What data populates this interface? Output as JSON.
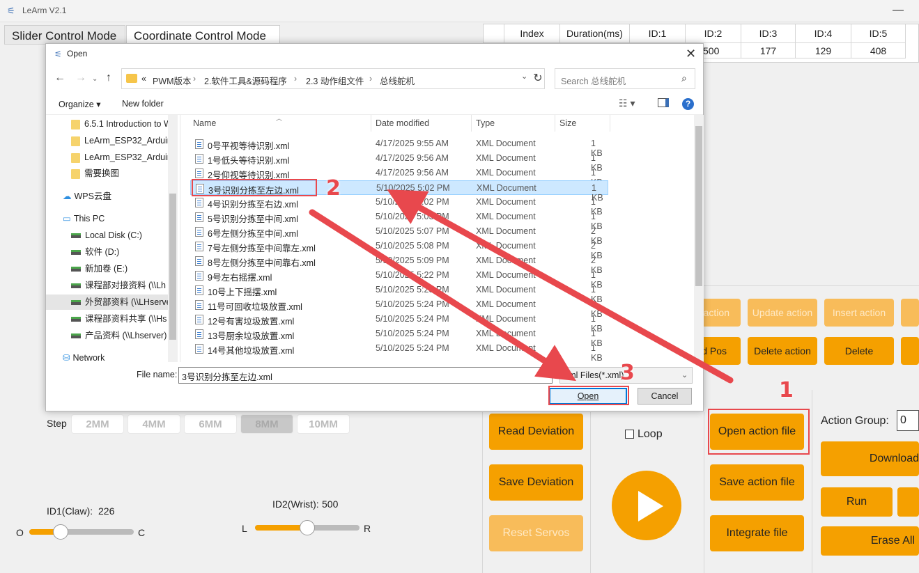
{
  "app": {
    "title": "LeArm V2.1",
    "minimize": "—"
  },
  "tabs": {
    "slider": "Slider Control Mode",
    "coordinate": "Coordinate Control Mode"
  },
  "grid": {
    "headers": [
      "Index",
      "Duration(ms)",
      "ID:1",
      "ID:2",
      "ID:3",
      "ID:4",
      "ID:5"
    ],
    "row": [
      "500",
      "177",
      "129",
      "408"
    ]
  },
  "step": {
    "label": "Step",
    "options": [
      "2MM",
      "4MM",
      "6MM",
      "8MM",
      "10MM"
    ],
    "selected": "8MM"
  },
  "sliders": {
    "id1": {
      "label": "ID1(Claw):",
      "value": "226",
      "left": "O",
      "right": "C",
      "level": 0.2
    },
    "id2": {
      "label": "ID2(Wrist):",
      "value": "500",
      "left": "L",
      "right": "R",
      "level": 0.5
    }
  },
  "buttons": {
    "action": "action",
    "update_action": "Update action",
    "insert_action": "Insert action",
    "d_pos": "d Pos",
    "delete_action": "Delete action",
    "delete": "Delete",
    "read_deviation": "Read Deviation",
    "save_deviation": "Save Deviation",
    "reset_servos": "Reset Servos",
    "loop": "Loop",
    "open_action_file": "Open action file",
    "save_action_file": "Save action file",
    "integrate_file": "Integrate file",
    "action_group_label": "Action Group:",
    "action_group_value": "0",
    "download": "Download",
    "run": "Run",
    "erase_all": "Erase All"
  },
  "dialog": {
    "title": "Open",
    "close": "✕",
    "breadcrumb": [
      "«",
      "PWM版本",
      "›",
      "2.软件工具&源码程序",
      "›",
      "2.3 动作组文件",
      "›",
      "总线舵机"
    ],
    "search_placeholder": "Search 总线舵机",
    "organize": "Organize ▾",
    "new_folder": "New folder",
    "nav": [
      {
        "label": "6.5.1 Introduction to W",
        "kind": "folder"
      },
      {
        "label": "LeArm_ESP32_Arduino",
        "kind": "folder"
      },
      {
        "label": "LeArm_ESP32_Arduino",
        "kind": "folder"
      },
      {
        "label": "需要换图",
        "kind": "folder"
      },
      {
        "label": "WPS云盘",
        "kind": "cloud"
      },
      {
        "label": "This PC",
        "kind": "pc"
      },
      {
        "label": "Local Disk (C:)",
        "kind": "drive"
      },
      {
        "label": "软件 (D:)",
        "kind": "drive"
      },
      {
        "label": "新加卷 (E:)",
        "kind": "drive"
      },
      {
        "label": "课程部对接资料 (\\\\Lh",
        "kind": "net"
      },
      {
        "label": "外贸部资料 (\\\\LHserve",
        "kind": "net"
      },
      {
        "label": "课程部资料共享 (\\\\Hs",
        "kind": "net"
      },
      {
        "label": "产品资料 (\\\\Lhserver)",
        "kind": "net"
      },
      {
        "label": "Network",
        "kind": "network"
      }
    ],
    "columns": {
      "name": "Name",
      "date": "Date modified",
      "type": "Type",
      "size": "Size"
    },
    "files": [
      {
        "name": "0号平视等待识别.xml",
        "date": "4/17/2025 9:55 AM",
        "type": "XML Document",
        "size": "1 KB"
      },
      {
        "name": "1号低头等待识别.xml",
        "date": "4/17/2025 9:56 AM",
        "type": "XML Document",
        "size": "1 KB"
      },
      {
        "name": "2号仰视等待识别.xml",
        "date": "4/17/2025 9:56 AM",
        "type": "XML Document",
        "size": "1 KB"
      },
      {
        "name": "3号识别分拣至左边.xml",
        "date": "5/10/2025 5:02 PM",
        "type": "XML Document",
        "size": "1 KB"
      },
      {
        "name": "4号识别分拣至右边.xml",
        "date": "5/10/2025 5:02 PM",
        "type": "XML Document",
        "size": "1 KB"
      },
      {
        "name": "5号识别分拣至中间.xml",
        "date": "5/10/2025 5:03 PM",
        "type": "XML Document",
        "size": "1 KB"
      },
      {
        "name": "6号左侧分拣至中间.xml",
        "date": "5/10/2025 5:07 PM",
        "type": "XML Document",
        "size": "2 KB"
      },
      {
        "name": "7号左侧分拣至中间靠左.xml",
        "date": "5/10/2025 5:08 PM",
        "type": "XML Document",
        "size": "2 KB"
      },
      {
        "name": "8号左侧分拣至中间靠右.xml",
        "date": "5/10/2025 5:09 PM",
        "type": "XML Document",
        "size": "2 KB"
      },
      {
        "name": "9号左右摇摆.xml",
        "date": "5/10/2025 5:22 PM",
        "type": "XML Document",
        "size": "1 KB"
      },
      {
        "name": "10号上下摇摆.xml",
        "date": "5/10/2025 5:23 PM",
        "type": "XML Document",
        "size": "1 KB"
      },
      {
        "name": "11号可回收垃圾放置.xml",
        "date": "5/10/2025 5:24 PM",
        "type": "XML Document",
        "size": "1 KB"
      },
      {
        "name": "12号有害垃圾放置.xml",
        "date": "5/10/2025 5:24 PM",
        "type": "XML Document",
        "size": "1 KB"
      },
      {
        "name": "13号厨余垃圾放置.xml",
        "date": "5/10/2025 5:24 PM",
        "type": "XML Document",
        "size": "1 KB"
      },
      {
        "name": "14号其他垃圾放置.xml",
        "date": "5/10/2025 5:24 PM",
        "type": "XML Document",
        "size": "1 KB"
      }
    ],
    "selected_index": 3,
    "file_name_label": "File name:",
    "file_name_value": "3号识别分拣至左边.xml",
    "filter": "xml Files(*.xml)",
    "open": "Open",
    "cancel": "Cancel"
  },
  "annotations": {
    "step1": "1",
    "step2": "2",
    "step3": "3",
    "color": "#e8484d"
  },
  "colors": {
    "accent": "#f5a000",
    "selection": "#cde8ff"
  }
}
